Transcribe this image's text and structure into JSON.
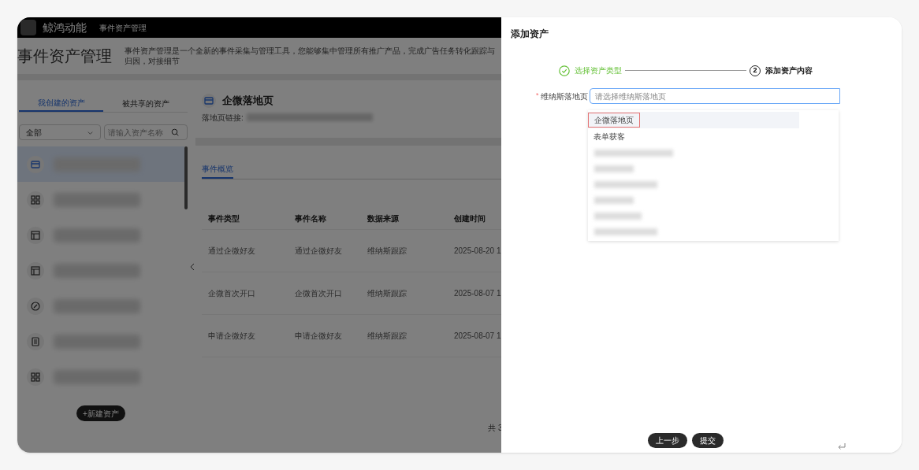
{
  "app_bar": {
    "brand": "鲸鸿动能",
    "nav": "事件资产管理"
  },
  "page": {
    "title": "事件资产管理",
    "description": "事件资产管理是一个全新的事件采集与管理工具，您能够集中管理所有推广产品，完成广告任务转化跟踪与归因，对接细节"
  },
  "sidebar": {
    "tabs": [
      {
        "label": "我创建的资产",
        "selected": true
      },
      {
        "label": "被共享的资产",
        "selected": false
      }
    ],
    "filter": {
      "value": "全部"
    },
    "search": {
      "placeholder": "请输入资产名称"
    },
    "items": [
      {
        "kind": "browser",
        "selected": true
      },
      {
        "kind": "grid",
        "selected": false
      },
      {
        "kind": "layout",
        "selected": false
      },
      {
        "kind": "layout",
        "selected": false
      },
      {
        "kind": "link",
        "selected": false
      },
      {
        "kind": "form",
        "selected": false
      },
      {
        "kind": "grid",
        "selected": false
      }
    ],
    "new_button": "+新建资产"
  },
  "detail": {
    "title": "企微落地页",
    "link_label": "落地页链接:",
    "tabs": [
      {
        "label": "事件概览",
        "selected": true
      }
    ],
    "table": {
      "columns": [
        "事件类型",
        "事件名称",
        "数据来源",
        "创建时间"
      ],
      "rows": [
        [
          "通过企微好友",
          "通过企微好友",
          "维纳斯跟踪",
          "2025-08-20 1"
        ],
        [
          "企微首次开口",
          "企微首次开口",
          "维纳斯跟踪",
          "2025-08-07 1"
        ],
        [
          "申请企微好友",
          "申请企微好友",
          "维纳斯跟踪",
          "2025-08-07 1"
        ]
      ]
    },
    "footer": "共 3"
  },
  "drawer": {
    "title": "添加资产",
    "steps": [
      {
        "label": "选择资产类型",
        "done": true
      },
      {
        "label": "添加资产内容",
        "number": "2",
        "done": false
      }
    ],
    "field": {
      "required_mark": "*",
      "label": "维纳斯落地页",
      "placeholder": "请选择维纳斯落地页",
      "focused": true
    },
    "options": [
      {
        "label": "企微落地页",
        "selected": true
      },
      {
        "label": "表单获客",
        "selected": false
      }
    ],
    "buttons": [
      "上一步",
      "提交"
    ]
  }
}
